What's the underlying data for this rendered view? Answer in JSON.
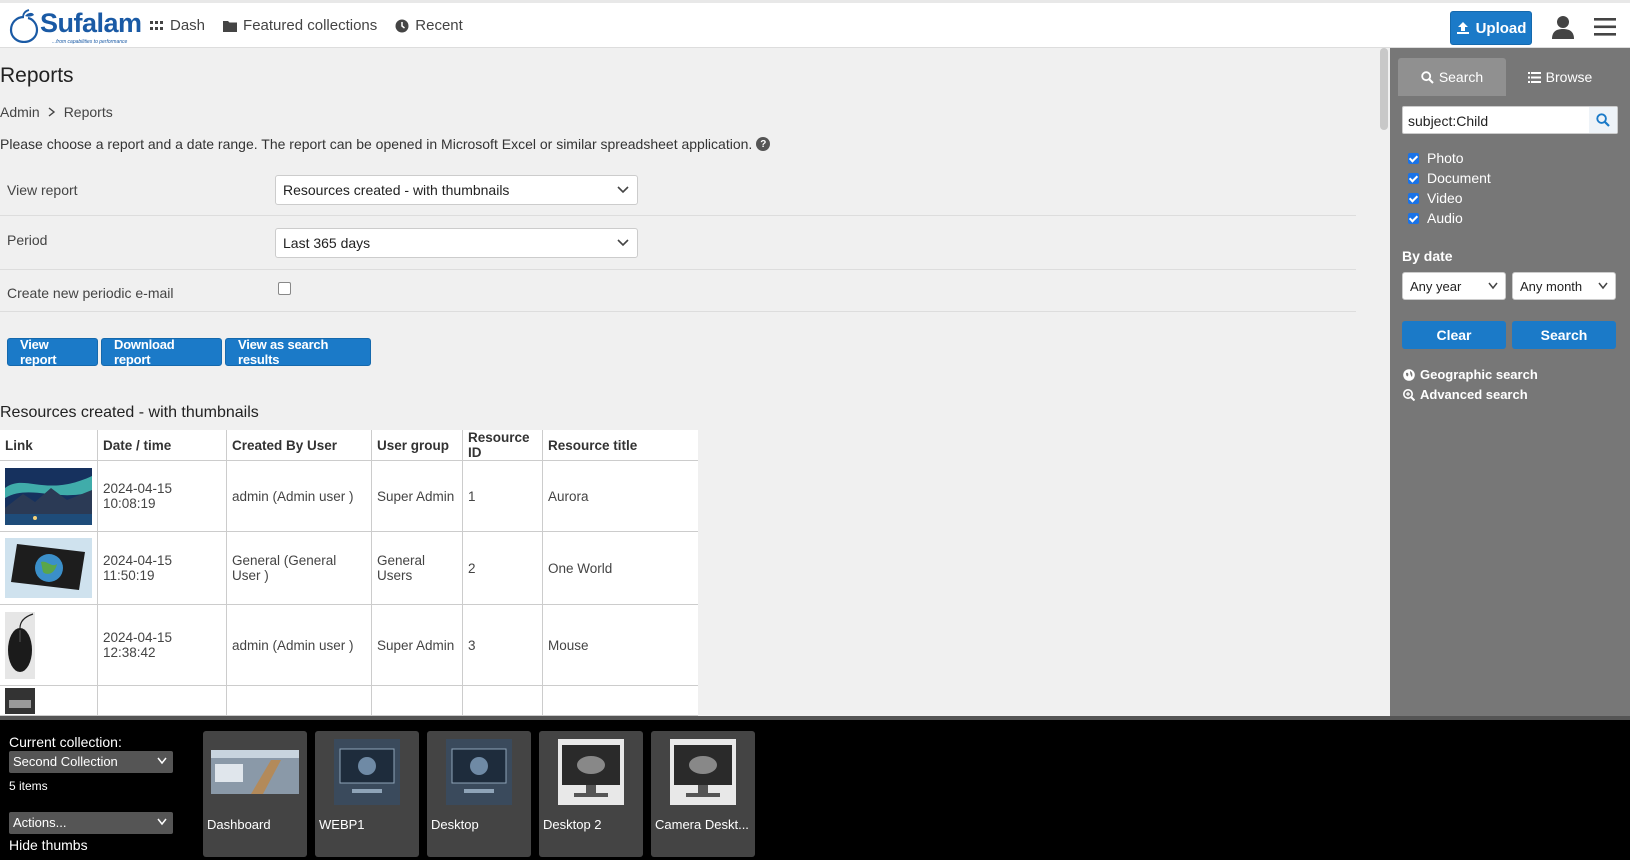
{
  "app": {
    "logo_text": "Sufalam",
    "logo_tagline": "...from capabilities to performance"
  },
  "nav": {
    "dash": "Dash",
    "featured": "Featured collections",
    "recent": "Recent"
  },
  "header": {
    "upload_label": "Upload"
  },
  "page": {
    "title": "Reports",
    "breadcrumb": [
      "Admin",
      "Reports"
    ],
    "intro": "Please choose a report and a date range. The report can be opened in Microsoft Excel or similar spreadsheet application.",
    "help_glyph": "?"
  },
  "form": {
    "view_report_label": "View report",
    "view_report_value": "Resources created - with thumbnails",
    "period_label": "Period",
    "period_value": "Last 365 days",
    "periodic_email_label": "Create new periodic e-mail"
  },
  "actions": {
    "view": "View report",
    "download": "Download report",
    "search_results": "View as search results"
  },
  "results": {
    "title": "Resources created - with thumbnails",
    "columns": [
      "Link",
      "Date / time",
      "Created By User",
      "User group",
      "Resource ID",
      "Resource title"
    ],
    "rows": [
      {
        "date": "2024-04-15 10:08:19",
        "user": "admin (Admin user )",
        "group": "Super Admin",
        "id": "1",
        "title": "Aurora",
        "thumb": "aurora-thumbnail"
      },
      {
        "date": "2024-04-15 11:50:19",
        "user": "General (General User )",
        "group": "General Users",
        "id": "2",
        "title": "One World",
        "thumb": "one-world-thumbnail"
      },
      {
        "date": "2024-04-15 12:38:42",
        "user": "admin (Admin user )",
        "group": "Super Admin",
        "id": "3",
        "title": "Mouse",
        "thumb": "mouse-thumbnail"
      }
    ]
  },
  "sidebar": {
    "tab_search": "Search",
    "tab_browse": "Browse",
    "search_value": "subject:Child",
    "types": [
      "Photo",
      "Document",
      "Video",
      "Audio"
    ],
    "by_date": "By date",
    "year": "Any year",
    "month": "Any month",
    "clear": "Clear",
    "search": "Search",
    "geo": "Geographic search",
    "advanced": "Advanced search"
  },
  "collection": {
    "current_label": "Current collection:",
    "name": "Second Collection",
    "count": "5 items",
    "actions": "Actions...",
    "hide_thumbs": "Hide thumbs",
    "items": [
      "Dashboard",
      "WEBP1",
      "Desktop",
      "Desktop 2",
      "Camera Deskt..."
    ]
  },
  "colors": {
    "accent": "#1b7ac8",
    "sidebar_bg": "#777777",
    "collection_bar_bg": "#000000"
  }
}
